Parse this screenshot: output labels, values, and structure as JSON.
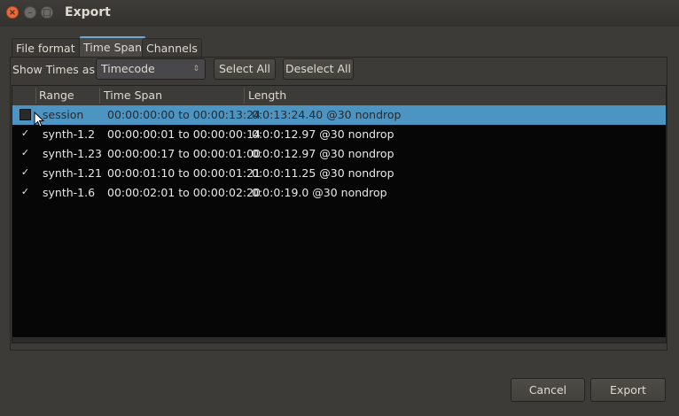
{
  "window": {
    "title": "Export",
    "close_glyph": "×",
    "min_glyph": "–",
    "max_glyph": "□"
  },
  "tabs": [
    {
      "label": "File format",
      "active": false
    },
    {
      "label": "Time Span",
      "active": true
    },
    {
      "label": "Channels",
      "active": false
    }
  ],
  "toolbar": {
    "show_times_label": "Show Times as:",
    "show_times_value": "Timecode",
    "select_all": "Select All",
    "deselect_all": "Deselect All"
  },
  "table": {
    "columns": [
      "Range",
      "Time Span",
      "Length"
    ],
    "rows": [
      {
        "checked": false,
        "selected": true,
        "range": "session",
        "span": "00:00:00:00 to 00:00:13:24",
        "length": "0:0:13:24.40 @30 nondrop"
      },
      {
        "checked": true,
        "selected": false,
        "range": "synth-1.2",
        "span": "00:00:00:01 to 00:00:00:14",
        "length": "0:0:0:12.97 @30 nondrop"
      },
      {
        "checked": true,
        "selected": false,
        "range": "synth-1.23",
        "span": "00:00:00:17 to 00:00:01:00",
        "length": "0:0:0:12.97 @30 nondrop"
      },
      {
        "checked": true,
        "selected": false,
        "range": "synth-1.21",
        "span": "00:00:01:10 to 00:00:01:21",
        "length": "0:0:0:11.25 @30 nondrop"
      },
      {
        "checked": true,
        "selected": false,
        "range": "synth-1.6",
        "span": "00:00:02:01 to 00:00:02:20",
        "length": "0:0:0:19.0 @30 nondrop"
      }
    ],
    "check_glyph": "✓"
  },
  "footer": {
    "cancel": "Cancel",
    "export": "Export"
  },
  "colors": {
    "background": "#3c3b37",
    "selection": "#4c94c2",
    "list_bg": "#060606",
    "close_button": "#ea6a3c",
    "tab_accent": "#6fa6d3"
  }
}
